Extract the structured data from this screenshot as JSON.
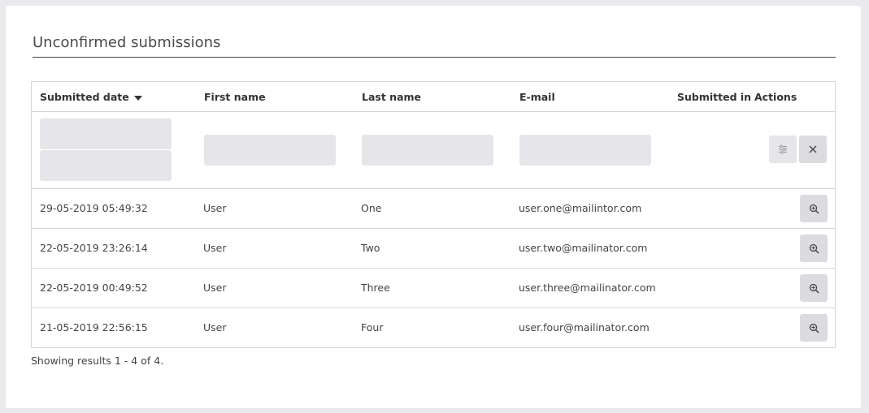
{
  "page": {
    "title": "Unconfirmed submissions"
  },
  "table": {
    "columns": [
      "Submitted date",
      "First name",
      "Last name",
      "E-mail",
      "Submitted in",
      "Actions"
    ],
    "rows": [
      {
        "date": "29-05-2019 05:49:32",
        "first": "User",
        "last": "One",
        "email": "user.one@mailintor.com"
      },
      {
        "date": "22-05-2019 23:26:14",
        "first": "User",
        "last": "Two",
        "email": "user.two@mailinator.com"
      },
      {
        "date": "22-05-2019 00:49:52",
        "first": "User",
        "last": "Three",
        "email": "user.three@mailinator.com"
      },
      {
        "date": "21-05-2019 22:56:15",
        "first": "User",
        "last": "Four",
        "email": "user.four@mailinator.com"
      }
    ],
    "sort": {
      "column": "Submitted date",
      "direction": "descending"
    }
  },
  "icons": {
    "filter": "filter-sliders-icon",
    "clear": "close-icon",
    "view": "zoom-in-icon"
  },
  "footer": {
    "results": "Showing results 1 - 4 of 4."
  }
}
